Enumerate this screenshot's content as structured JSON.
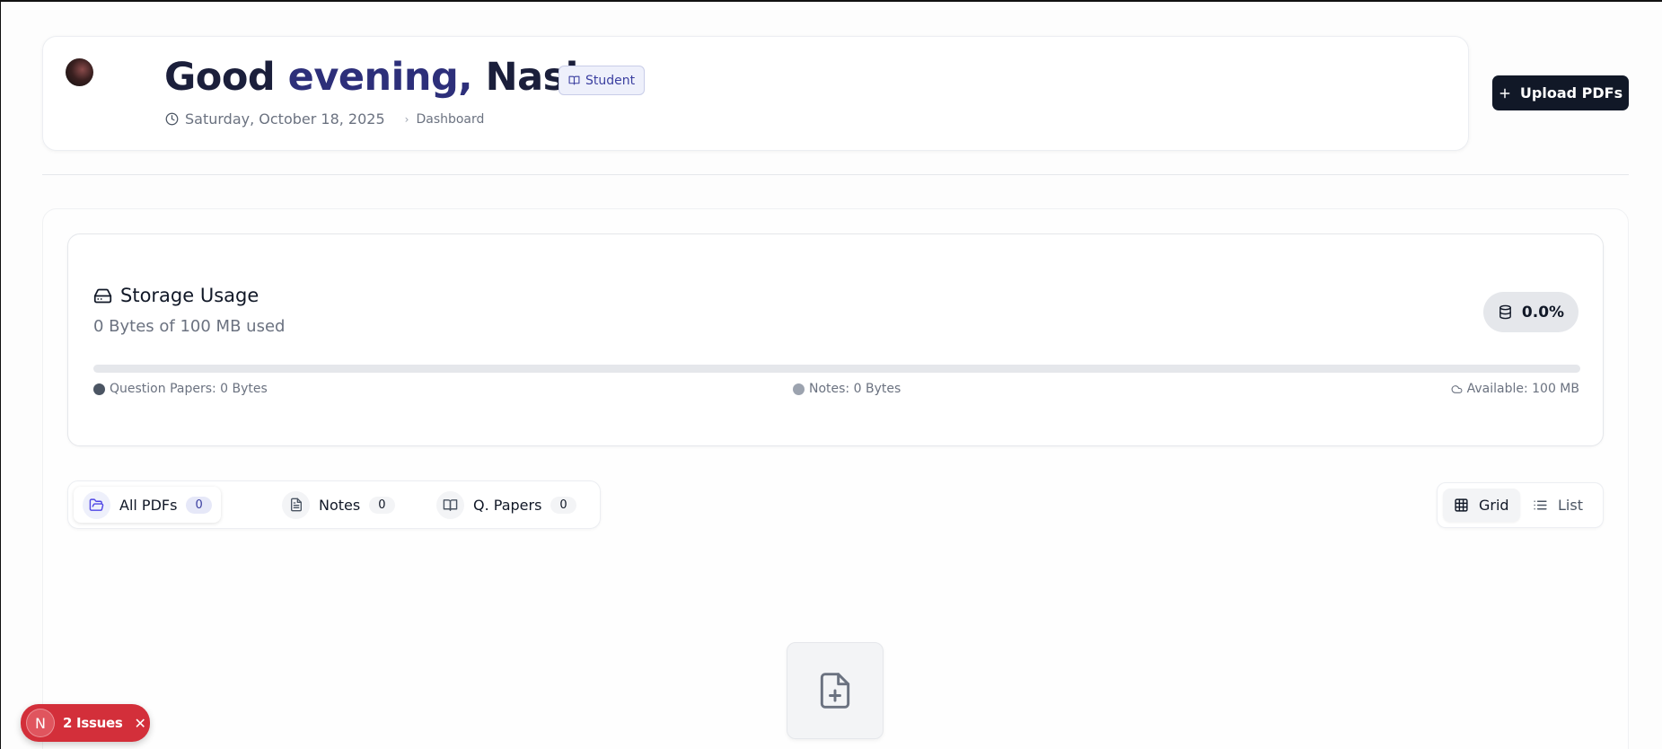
{
  "header": {
    "greeting_prefix": "Good",
    "greeting_accent": "evening,",
    "greeting_name": "Nash",
    "role": "Student",
    "date": "Saturday, October 18, 2025",
    "breadcrumb": "Dashboard",
    "upload_label": "Upload PDFs"
  },
  "storage": {
    "title": "Storage Usage",
    "subtitle": "0 Bytes of 100 MB used",
    "percent_label": "0.0%",
    "used_fraction": 0.0,
    "legend": {
      "question_papers": "Question Papers: 0 Bytes",
      "notes": "Notes: 0 Bytes",
      "available": "Available: 100 MB"
    },
    "colors": {
      "question_papers": "#4b5563",
      "notes": "#9ca3af"
    }
  },
  "tabs": [
    {
      "label": "All PDFs",
      "count": "0",
      "icon": "folder-open-icon",
      "active": true
    },
    {
      "label": "Notes",
      "count": "0",
      "icon": "file-text-icon",
      "active": false
    },
    {
      "label": "Q. Papers",
      "count": "0",
      "icon": "book-open-icon",
      "active": false
    }
  ],
  "view": {
    "grid_label": "Grid",
    "list_label": "List",
    "selected": "grid"
  },
  "empty_state": {
    "icon": "file-plus-icon"
  },
  "issues_toast": {
    "logo_letter": "N",
    "label": "2 Issues"
  },
  "colors": {
    "accent": "#2d2f7a",
    "primary_button": "#111827",
    "issues": "#d32f3a"
  }
}
